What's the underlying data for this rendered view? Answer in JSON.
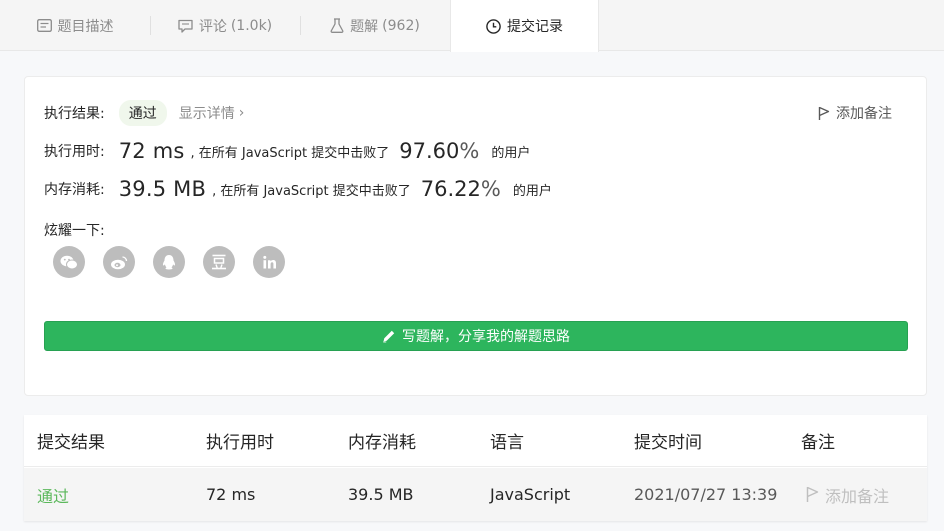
{
  "tabs": [
    {
      "label": "题目描述",
      "count": "",
      "icon": "description-icon"
    },
    {
      "label": "评论",
      "count": "(1.0k)",
      "icon": "comment-icon"
    },
    {
      "label": "题解",
      "count": "(962)",
      "icon": "flask-icon"
    },
    {
      "label": "提交记录",
      "count": "",
      "icon": "clock-icon",
      "active": true
    }
  ],
  "result": {
    "status_label": "执行结果:",
    "status_value": "通过",
    "detail_link": "显示详情",
    "add_note": "添加备注",
    "runtime_label": "执行用时:",
    "runtime_value": "72 ms",
    "runtime_text": ", 在所有 JavaScript 提交中击败了",
    "runtime_pct": "97.60",
    "memory_label": "内存消耗:",
    "memory_value": "39.5 MB",
    "memory_text": ", 在所有 JavaScript 提交中击败了",
    "memory_pct": "76.22",
    "pct_unit": "%",
    "users_text": "的用户",
    "share_label": "炫耀一下:",
    "share_icons": [
      "wechat-icon",
      "weibo-icon",
      "qq-icon",
      "douban-icon",
      "linkedin-icon"
    ],
    "write_button": "写题解，分享我的解题思路"
  },
  "table": {
    "headers": [
      "提交结果",
      "执行用时",
      "内存消耗",
      "语言",
      "提交时间",
      "备注"
    ],
    "rows": [
      {
        "result": "通过",
        "runtime": "72 ms",
        "memory": "39.5 MB",
        "language": "JavaScript",
        "time": "2021/07/27 13:39",
        "note": "添加备注"
      }
    ]
  },
  "colors": {
    "accent": "#2db55d",
    "success_text": "#5cb85c"
  }
}
